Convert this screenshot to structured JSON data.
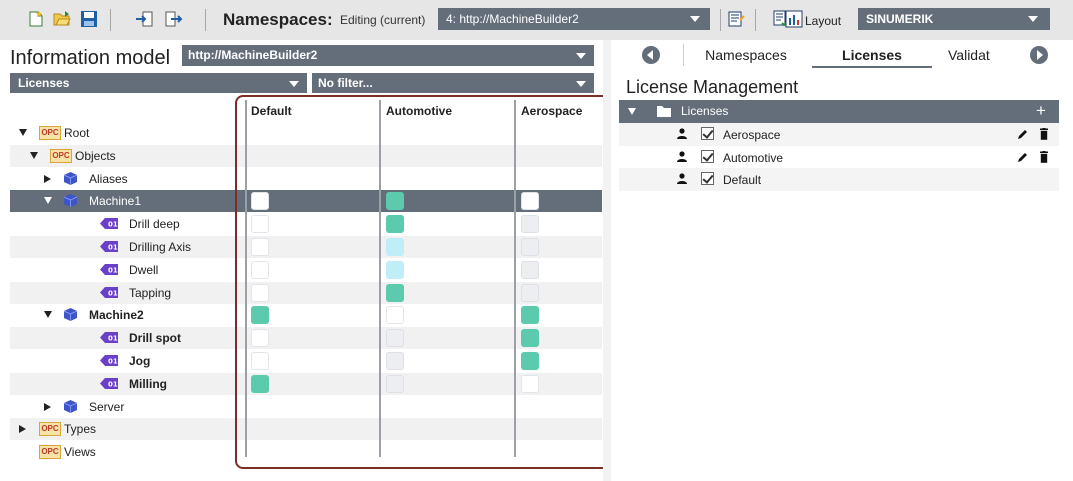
{
  "toolbar": {
    "namespaces_label": "Namespaces:",
    "editing_label": "Editing (current)",
    "namespace_value": "4: http://MachineBuilder2",
    "layout_label": "Layout",
    "layout_value": "SINUMERIK"
  },
  "info_model": {
    "title": "Information model",
    "model_value": "http://MachineBuilder2",
    "view_value": "Licenses",
    "filter_value": "No filter...",
    "columns": [
      "Default",
      "Automotive",
      "Aerospace"
    ],
    "tree": [
      {
        "label": "Root",
        "icon": "opc-folder-icon",
        "expander": "expanded",
        "bold": false,
        "cells": null
      },
      {
        "label": "Objects",
        "icon": "opc-folder-icon",
        "expander": "expanded",
        "bold": false,
        "cells": null
      },
      {
        "label": "Aliases",
        "icon": "object-cube-icon",
        "expander": "collapsed",
        "bold": false,
        "cells": null
      },
      {
        "label": "Machine1",
        "icon": "object-cube-icon",
        "expander": "expanded",
        "bold": false,
        "selected": true,
        "cells": [
          "white",
          "teal",
          "white"
        ]
      },
      {
        "label": "Drill deep",
        "icon": "method-icon",
        "expander": "none",
        "bold": false,
        "cells": [
          "white",
          "teal",
          "gray"
        ]
      },
      {
        "label": "Drilling Axis",
        "icon": "method-icon",
        "expander": "none",
        "bold": false,
        "cells": [
          "white",
          "light",
          "gray"
        ]
      },
      {
        "label": "Dwell",
        "icon": "method-icon",
        "expander": "none",
        "bold": false,
        "cells": [
          "white",
          "light",
          "gray"
        ]
      },
      {
        "label": "Tapping",
        "icon": "method-icon",
        "expander": "none",
        "bold": false,
        "cells": [
          "white",
          "teal",
          "gray"
        ]
      },
      {
        "label": "Machine2",
        "icon": "object-cube-icon",
        "expander": "expanded",
        "bold": true,
        "cells": [
          "teal",
          "white",
          "teal"
        ]
      },
      {
        "label": "Drill spot",
        "icon": "method-icon",
        "expander": "none",
        "bold": true,
        "cells": [
          "white",
          "gray",
          "teal"
        ]
      },
      {
        "label": "Jog",
        "icon": "method-icon",
        "expander": "none",
        "bold": true,
        "cells": [
          "white",
          "gray",
          "teal"
        ]
      },
      {
        "label": "Milling",
        "icon": "method-icon",
        "expander": "none",
        "bold": true,
        "cells": [
          "teal",
          "gray",
          "white"
        ]
      },
      {
        "label": "Server",
        "icon": "object-cube-icon",
        "expander": "collapsed",
        "bold": false,
        "cells": null
      },
      {
        "label": "Types",
        "icon": "opc-folder-icon",
        "expander": "collapsed",
        "bold": false,
        "cells": null
      },
      {
        "label": "Views",
        "icon": "opc-folder-icon",
        "expander": "none",
        "bold": false,
        "cells": null
      }
    ],
    "opc_badge": "OPC",
    "method_badge": "01"
  },
  "right": {
    "tabs": [
      "Namespaces",
      "Licenses",
      "Validat"
    ],
    "active_tab": "Licenses",
    "title": "License Management",
    "group_label": "Licenses",
    "add_glyph": "+",
    "licenses": [
      {
        "name": "Aerospace",
        "checked": true,
        "actions": true
      },
      {
        "name": "Automotive",
        "checked": true,
        "actions": true
      },
      {
        "name": "Default",
        "checked": true,
        "actions": false
      }
    ]
  },
  "colors": {
    "dropdown_bg": "#646e7a",
    "teal_cell": "#5ccaad",
    "light_cell": "#bfeef8",
    "highlight_border": "#7a2e26"
  }
}
